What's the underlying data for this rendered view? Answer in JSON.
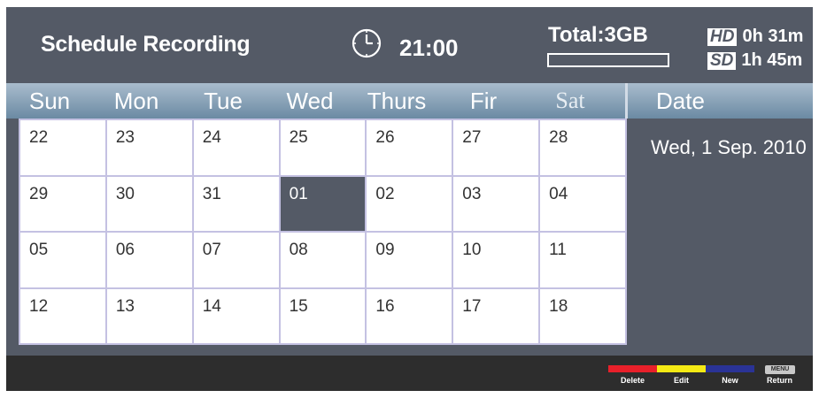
{
  "header": {
    "title": "Schedule Recording",
    "clock_icon": "clock-icon",
    "time": "21:00",
    "total": "Total:3GB",
    "usage_fraction": 0.0,
    "hd_tag": "HD",
    "hd_time": "0h 31m",
    "sd_tag": "SD",
    "sd_time": "1h 45m"
  },
  "weekdays": [
    "Sun",
    "Mon",
    "Tue",
    "Wed",
    "Thurs",
    "Fir",
    "Sat"
  ],
  "date_panel": {
    "heading": "Date",
    "value": "Wed, 1 Sep. 2010"
  },
  "calendar": {
    "weeks": [
      [
        "22",
        "23",
        "24",
        "25",
        "26",
        "27",
        "28"
      ],
      [
        "29",
        "30",
        "31",
        "01",
        "02",
        "03",
        "04"
      ],
      [
        "05",
        "06",
        "07",
        "08",
        "09",
        "10",
        "11"
      ],
      [
        "12",
        "13",
        "14",
        "15",
        "16",
        "17",
        "18"
      ]
    ],
    "selected": "01"
  },
  "footer": {
    "keys": [
      {
        "label": "Delete",
        "color": "#e8202a"
      },
      {
        "label": "Edit",
        "color": "#f5ea14"
      },
      {
        "label": "New",
        "color": "#2a3396"
      }
    ],
    "menu_button": "MENU",
    "menu_label": "Return"
  }
}
